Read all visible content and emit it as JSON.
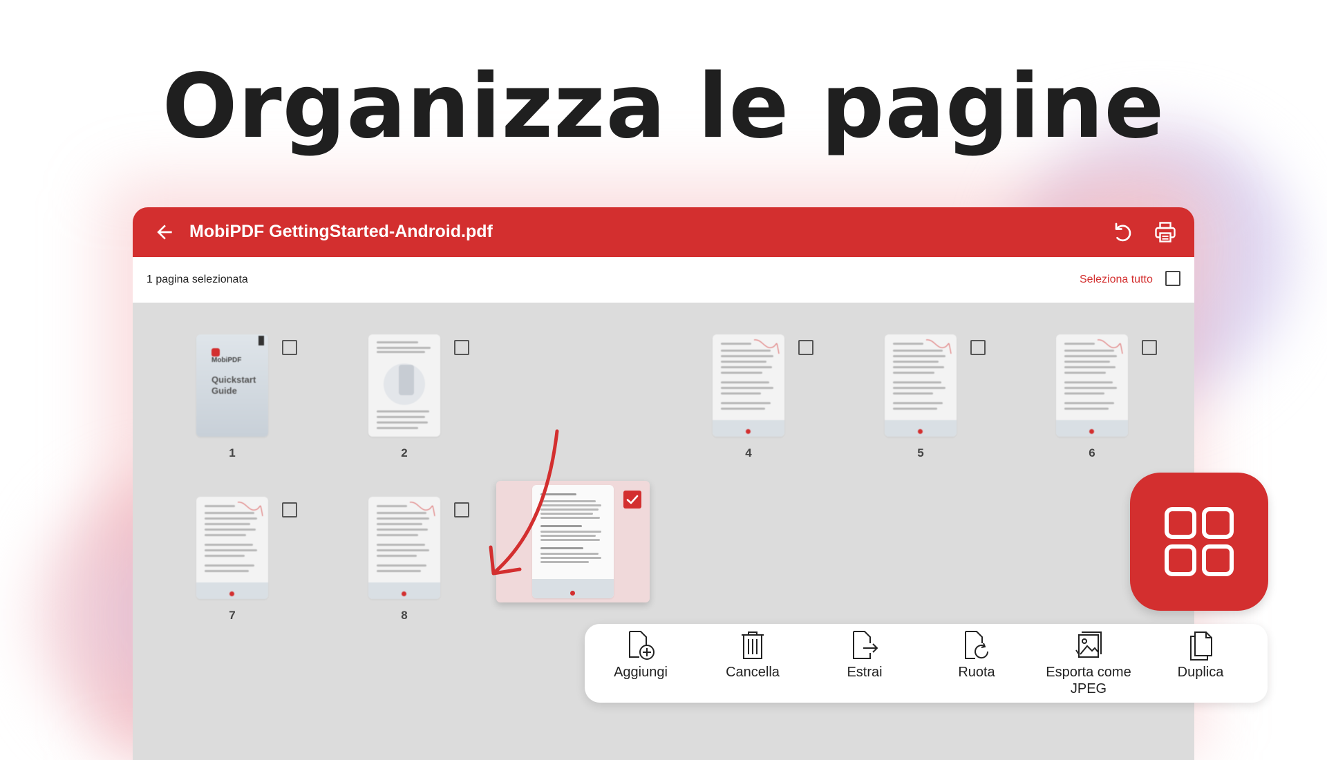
{
  "headline": "Organizza le pagine",
  "colors": {
    "brand_red": "#d32f2f",
    "grid_bg": "#dcdcdc",
    "selected_bg": "#f0d9da"
  },
  "app": {
    "title": "MobiPDF GettingStarted-Android.pdf",
    "back_icon": "arrow-left-icon",
    "undo_icon": "undo-icon",
    "print_icon": "print-icon"
  },
  "selection_bar": {
    "count_text": "1 pagina selezionata",
    "select_all_label": "Seleziona tutto",
    "select_all_checked": false
  },
  "cover": {
    "logo_text": "MobiPDF",
    "title_line1": "Quickstart",
    "title_line2": "Guide"
  },
  "pages": [
    {
      "number": "1",
      "checked": false,
      "type": "cover"
    },
    {
      "number": "2",
      "checked": false,
      "type": "text"
    },
    {
      "number": "",
      "checked": true,
      "type": "text",
      "dragging": true
    },
    {
      "number": "4",
      "checked": false,
      "type": "text"
    },
    {
      "number": "5",
      "checked": false,
      "type": "text"
    },
    {
      "number": "6",
      "checked": false,
      "type": "text"
    },
    {
      "number": "7",
      "checked": false,
      "type": "text"
    },
    {
      "number": "8",
      "checked": false,
      "type": "text"
    }
  ],
  "fab_icon": "grid-four-icon",
  "actions": [
    {
      "label": "Aggiungi",
      "icon": "file-add-icon"
    },
    {
      "label": "Cancella",
      "icon": "trash-icon"
    },
    {
      "label": "Estrai",
      "icon": "file-export-icon"
    },
    {
      "label": "Ruota",
      "icon": "file-rotate-icon"
    },
    {
      "label": "Esporta come JPEG",
      "icon": "image-export-icon"
    },
    {
      "label": "Duplica",
      "icon": "duplicate-icon"
    }
  ]
}
